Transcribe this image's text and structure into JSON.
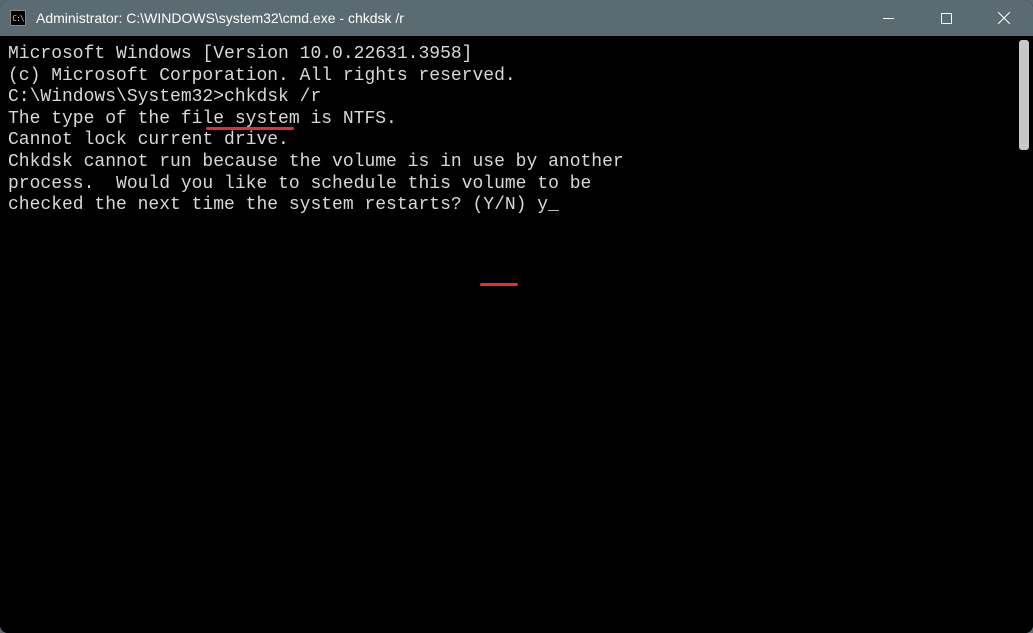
{
  "window": {
    "title": "Administrator: C:\\WINDOWS\\system32\\cmd.exe - chkdsk  /r",
    "icon_label": "C:\\"
  },
  "terminal": {
    "line1": "Microsoft Windows [Version 10.0.22631.3958]",
    "line2": "(c) Microsoft Corporation. All rights reserved.",
    "blank1": "",
    "prompt_prefix": "C:\\Windows\\System32>",
    "command": "chkdsk /r",
    "line4": "The type of the file system is NTFS.",
    "line5": "Cannot lock current drive.",
    "blank2": "",
    "line6": "Chkdsk cannot run because the volume is in use by another",
    "line7": "process.  Would you like to schedule this volume to be",
    "line8_prefix": "checked the next time the system restarts? (Y/N) ",
    "answer": "y",
    "cursor": "_"
  }
}
